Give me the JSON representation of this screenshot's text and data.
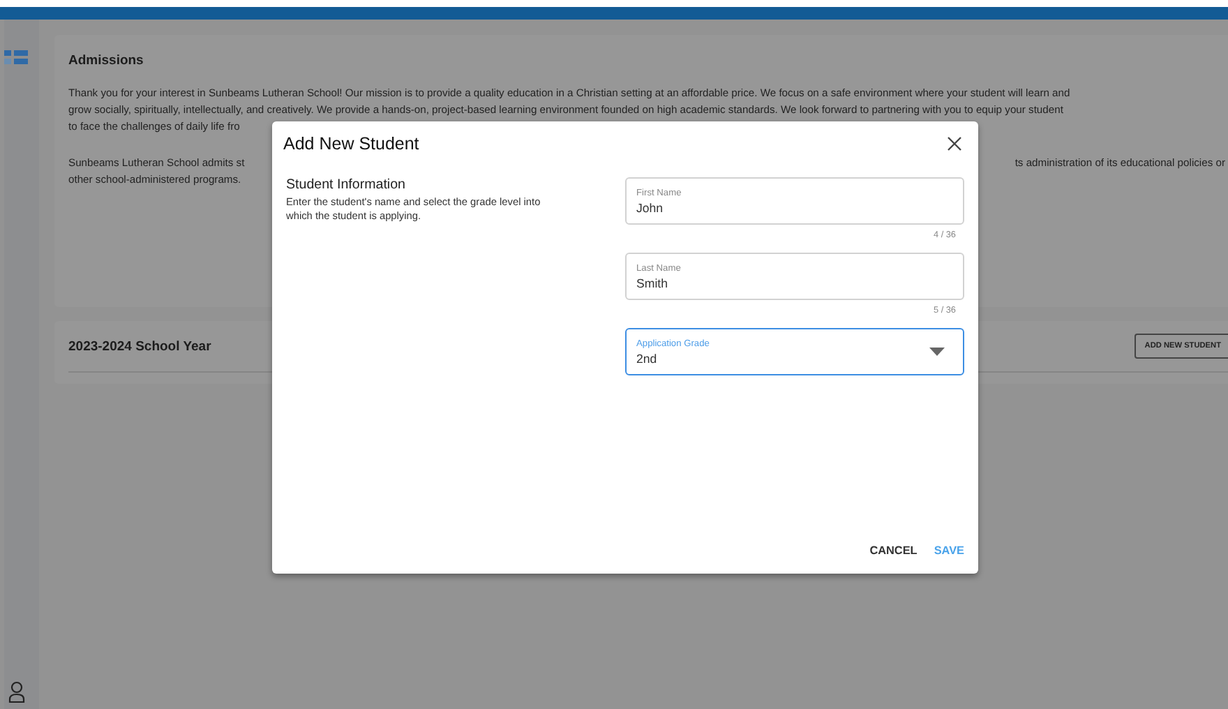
{
  "admissions": {
    "title": "Admissions",
    "lines": [
      {
        "left": "Thank you for your interest in Sunbeams Lutheran School! Our mission is to provide a quality education in a Christian setting at an affordable price. We focus on a safe environment where your student will learn and"
      },
      {
        "left": "grow socially, spiritually, intellectually, and creatively. We provide a hands-on, project-based learning environment founded on high academic standards. We look forward to partnering with you to equip your student"
      },
      {
        "left": "to face the challenges of daily life fro"
      },
      {
        "left": "Sunbeams Lutheran School admits st",
        "right": "ts administration of its educational policies or",
        "gap_before": true
      },
      {
        "left": "other school-administered programs."
      }
    ]
  },
  "school_year": {
    "title": "2023-2024 School Year",
    "button": "ADD NEW STUDENT"
  },
  "dialog": {
    "title": "Add New Student",
    "section_title": "Student Information",
    "section_description": "Enter the student's name and select the grade level into which the student is applying.",
    "fields": [
      {
        "kind": "text",
        "label": "First Name",
        "value": "John",
        "counter": "4 / 36",
        "focused": false
      },
      {
        "kind": "text",
        "label": "Last Name",
        "value": "Smith",
        "counter": "5 / 36",
        "focused": false
      },
      {
        "kind": "select",
        "label": "Application Grade",
        "value": "2nd",
        "focused": true
      }
    ],
    "buttons": [
      {
        "label": "CANCEL",
        "primary": false
      },
      {
        "label": "SAVE",
        "primary": true
      }
    ]
  }
}
